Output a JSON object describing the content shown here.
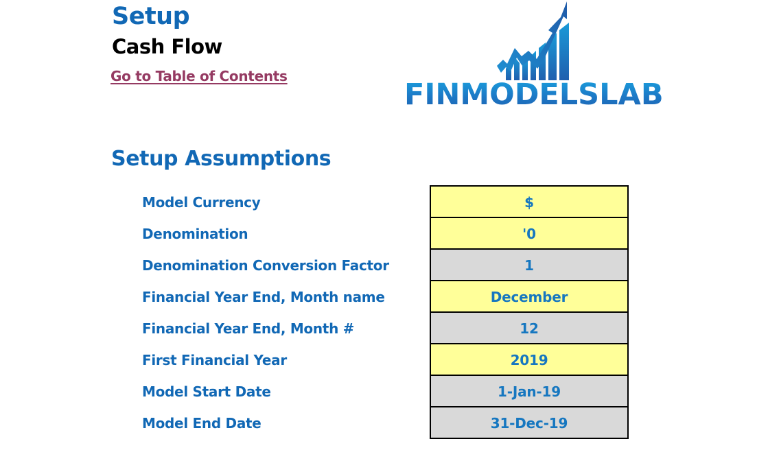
{
  "header": {
    "title": "Setup",
    "subtitle": "Cash Flow",
    "toc_link": "Go to Table of Contents"
  },
  "logo": {
    "text": "FINMODELSLAB",
    "icon": "rising-chart-arrow-icon",
    "colors": {
      "light": "#1aa3e0",
      "mid": "#1c79c6",
      "dark": "#1f5fae"
    }
  },
  "section": {
    "title": "Setup Assumptions"
  },
  "assumptions": [
    {
      "label": "Model Currency",
      "value": "$",
      "type": "input"
    },
    {
      "label": "Denomination",
      "value": "'0",
      "type": "input"
    },
    {
      "label": "Denomination Conversion Factor",
      "value": "1",
      "type": "calc"
    },
    {
      "label": "Financial Year End, Month name",
      "value": "December",
      "type": "input"
    },
    {
      "label": "Financial Year End, Month #",
      "value": "12",
      "type": "calc"
    },
    {
      "label": "First Financial Year",
      "value": "2019",
      "type": "input"
    },
    {
      "label": "Model Start Date",
      "value": "1-Jan-19",
      "type": "calc"
    },
    {
      "label": "Model End Date",
      "value": "31-Dec-19",
      "type": "calc"
    }
  ],
  "colors": {
    "heading_blue": "#1168b5",
    "value_blue": "#1677c0",
    "link_purple": "#953a62",
    "input_fill": "#ffff99",
    "calc_fill": "#d9d9d9",
    "border": "#000000"
  }
}
